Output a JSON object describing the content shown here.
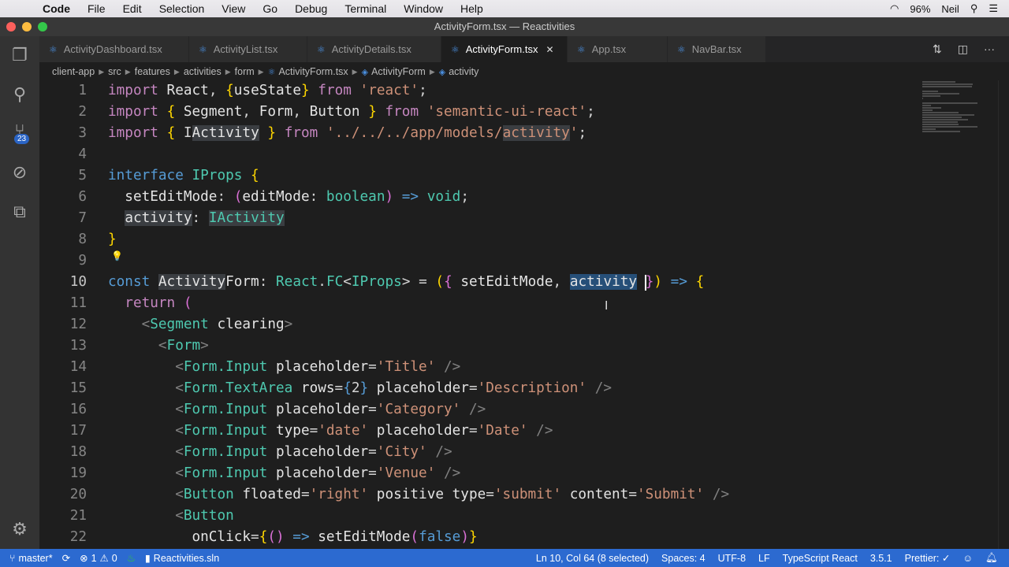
{
  "menubar": {
    "app": "Code",
    "items": [
      "File",
      "Edit",
      "Selection",
      "View",
      "Go",
      "Debug",
      "Terminal",
      "Window",
      "Help"
    ],
    "battery": "96%",
    "user": "Neil"
  },
  "window": {
    "title": "ActivityForm.tsx — Reactivities"
  },
  "activity_bar": {
    "scm_badge": "23"
  },
  "tabs": [
    {
      "label": "ActivityDashboard.tsx"
    },
    {
      "label": "ActivityList.tsx"
    },
    {
      "label": "ActivityDetails.tsx"
    },
    {
      "label": "ActivityForm.tsx",
      "active": true
    },
    {
      "label": "App.tsx"
    },
    {
      "label": "NavBar.tsx"
    }
  ],
  "breadcrumb": [
    "client-app",
    "src",
    "features",
    "activities",
    "form",
    "ActivityForm.tsx",
    "ActivityForm",
    "activity"
  ],
  "editor": {
    "current_line": 10,
    "lines": [
      [
        [
          "kw",
          "import"
        ],
        [
          "id",
          " React"
        ],
        [
          "p",
          ", "
        ],
        [
          "br",
          "{"
        ],
        [
          "id",
          "useState"
        ],
        [
          "br",
          "}"
        ],
        [
          "kw",
          " from"
        ],
        [
          "s",
          " 'react'"
        ],
        [
          "p",
          ";"
        ]
      ],
      [
        [
          "kw",
          "import"
        ],
        [
          "p",
          " "
        ],
        [
          "br",
          "{"
        ],
        [
          "id",
          " Segment"
        ],
        [
          "p",
          ", "
        ],
        [
          "id",
          "Form"
        ],
        [
          "p",
          ", "
        ],
        [
          "id",
          "Button "
        ],
        [
          "br",
          "}"
        ],
        [
          "kw",
          " from"
        ],
        [
          "s",
          " 'semantic-ui-react'"
        ],
        [
          "p",
          ";"
        ]
      ],
      [
        [
          "kw",
          "import"
        ],
        [
          "p",
          " "
        ],
        [
          "br",
          "{"
        ],
        [
          "p",
          " I"
        ],
        [
          "id hl",
          "Activity"
        ],
        [
          "p",
          " "
        ],
        [
          "br",
          "}"
        ],
        [
          "kw",
          " from"
        ],
        [
          "s",
          " '../../../app/models/"
        ],
        [
          "s hl",
          "activity"
        ],
        [
          "s",
          "'"
        ],
        [
          "p",
          ";"
        ]
      ],
      [],
      [
        [
          "st",
          "interface"
        ],
        [
          "ty",
          " IProps"
        ],
        [
          "p",
          " "
        ],
        [
          "br",
          "{"
        ]
      ],
      [
        [
          "id",
          "  setEditMode"
        ],
        [
          "p",
          ": "
        ],
        [
          "pk",
          "("
        ],
        [
          "id",
          "editMode"
        ],
        [
          "p",
          ": "
        ],
        [
          "ty",
          "boolean"
        ],
        [
          "pk",
          ")"
        ],
        [
          "st",
          " =>"
        ],
        [
          "ty",
          " void"
        ],
        [
          "p",
          ";"
        ]
      ],
      [
        [
          "p",
          "  "
        ],
        [
          "id hl",
          "activity"
        ],
        [
          "p",
          ": "
        ],
        [
          "ty hl",
          "IActivity"
        ]
      ],
      [
        [
          "br",
          "}"
        ]
      ],
      [],
      [
        [
          "st",
          "const"
        ],
        [
          "p",
          " "
        ],
        [
          "id hl",
          "Activity"
        ],
        [
          "id",
          "Form"
        ],
        [
          "p",
          ": "
        ],
        [
          "ty",
          "React"
        ],
        [
          "p",
          "."
        ],
        [
          "ty",
          "FC"
        ],
        [
          "p",
          "<"
        ],
        [
          "ty",
          "IProps"
        ],
        [
          "p",
          "> = "
        ],
        [
          "br",
          "("
        ],
        [
          "pk",
          "{"
        ],
        [
          "id",
          " setEditMode"
        ],
        [
          "p",
          ", "
        ],
        [
          "id sel",
          "activity"
        ],
        [
          "p",
          " "
        ],
        [
          "pk",
          "}"
        ],
        [
          "br",
          ")"
        ],
        [
          "st",
          " =>"
        ],
        [
          "p",
          " "
        ],
        [
          "br",
          "{"
        ]
      ],
      [
        [
          "kw",
          "  return"
        ],
        [
          "p",
          " "
        ],
        [
          "pk",
          "("
        ]
      ],
      [
        [
          "tg",
          "    <"
        ],
        [
          "ty",
          "Segment"
        ],
        [
          "id",
          " clearing"
        ],
        [
          "tg",
          ">"
        ]
      ],
      [
        [
          "tg",
          "      <"
        ],
        [
          "ty",
          "Form"
        ],
        [
          "tg",
          ">"
        ]
      ],
      [
        [
          "tg",
          "        <"
        ],
        [
          "ty",
          "Form.Input"
        ],
        [
          "id",
          " placeholder"
        ],
        [
          "p",
          "="
        ],
        [
          "s",
          "'Title'"
        ],
        [
          "tg",
          " />"
        ]
      ],
      [
        [
          "tg",
          "        <"
        ],
        [
          "ty",
          "Form.TextArea"
        ],
        [
          "id",
          " rows"
        ],
        [
          "p",
          "="
        ],
        [
          "bl",
          "{"
        ],
        [
          "p",
          "2"
        ],
        [
          "bl",
          "}"
        ],
        [
          "id",
          " placeholder"
        ],
        [
          "p",
          "="
        ],
        [
          "s",
          "'Description'"
        ],
        [
          "tg",
          " />"
        ]
      ],
      [
        [
          "tg",
          "        <"
        ],
        [
          "ty",
          "Form.Input"
        ],
        [
          "id",
          " placeholder"
        ],
        [
          "p",
          "="
        ],
        [
          "s",
          "'Category'"
        ],
        [
          "tg",
          " />"
        ]
      ],
      [
        [
          "tg",
          "        <"
        ],
        [
          "ty",
          "Form.Input"
        ],
        [
          "id",
          " type"
        ],
        [
          "p",
          "="
        ],
        [
          "s",
          "'date'"
        ],
        [
          "id",
          " placeholder"
        ],
        [
          "p",
          "="
        ],
        [
          "s",
          "'Date'"
        ],
        [
          "tg",
          " />"
        ]
      ],
      [
        [
          "tg",
          "        <"
        ],
        [
          "ty",
          "Form.Input"
        ],
        [
          "id",
          " placeholder"
        ],
        [
          "p",
          "="
        ],
        [
          "s",
          "'City'"
        ],
        [
          "tg",
          " />"
        ]
      ],
      [
        [
          "tg",
          "        <"
        ],
        [
          "ty",
          "Form.Input"
        ],
        [
          "id",
          " placeholder"
        ],
        [
          "p",
          "="
        ],
        [
          "s",
          "'Venue'"
        ],
        [
          "tg",
          " />"
        ]
      ],
      [
        [
          "tg",
          "        <"
        ],
        [
          "ty",
          "Button"
        ],
        [
          "id",
          " floated"
        ],
        [
          "p",
          "="
        ],
        [
          "s",
          "'right'"
        ],
        [
          "id",
          " positive type"
        ],
        [
          "p",
          "="
        ],
        [
          "s",
          "'submit'"
        ],
        [
          "id",
          " content"
        ],
        [
          "p",
          "="
        ],
        [
          "s",
          "'Submit'"
        ],
        [
          "tg",
          " />"
        ]
      ],
      [
        [
          "tg",
          "        <"
        ],
        [
          "ty",
          "Button"
        ]
      ],
      [
        [
          "id",
          "          onClick"
        ],
        [
          "p",
          "="
        ],
        [
          "br",
          "{"
        ],
        [
          "pk",
          "()"
        ],
        [
          "st",
          " =>"
        ],
        [
          "id",
          " setEditMode"
        ],
        [
          "pk",
          "("
        ],
        [
          "st",
          "false"
        ],
        [
          "pk",
          ")"
        ],
        [
          "br",
          "}"
        ]
      ]
    ]
  },
  "status": {
    "branch": "master*",
    "errors": "1",
    "warnings": "0",
    "solution": "Reactivities.sln",
    "position": "Ln 10, Col 64 (8 selected)",
    "spaces": "Spaces: 4",
    "encoding": "UTF-8",
    "eol": "LF",
    "language": "TypeScript React",
    "version": "3.5.1",
    "prettier": "Prettier: ✓"
  }
}
